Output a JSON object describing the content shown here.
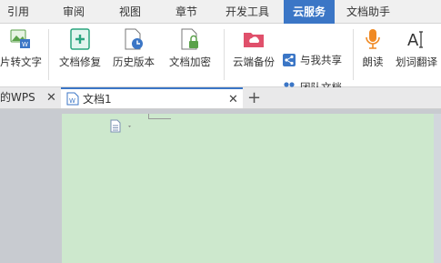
{
  "ribbon_tabs": [
    {
      "label": "引用"
    },
    {
      "label": "审阅"
    },
    {
      "label": "视图"
    },
    {
      "label": "章节"
    },
    {
      "label": "开发工具"
    },
    {
      "label": "云服务",
      "active": true
    },
    {
      "label": "文档助手"
    }
  ],
  "toolbar": {
    "pic_to_text": "片转文字",
    "doc_repair": "文档修复",
    "history": "历史版本",
    "encrypt": "文档加密",
    "cloud_backup": "云端备份",
    "share_with_me": "与我共享",
    "team_docs": "团队文档",
    "read_aloud": "朗读",
    "translate": "划词翻译"
  },
  "doc_tabs": {
    "wps_tab": "的WPS",
    "current_doc": "文档1",
    "new_tab": "+"
  },
  "colors": {
    "accent": "#3b76c6",
    "page_bg": "#cde8cd",
    "workspace_bg": "#c8cbd0"
  }
}
